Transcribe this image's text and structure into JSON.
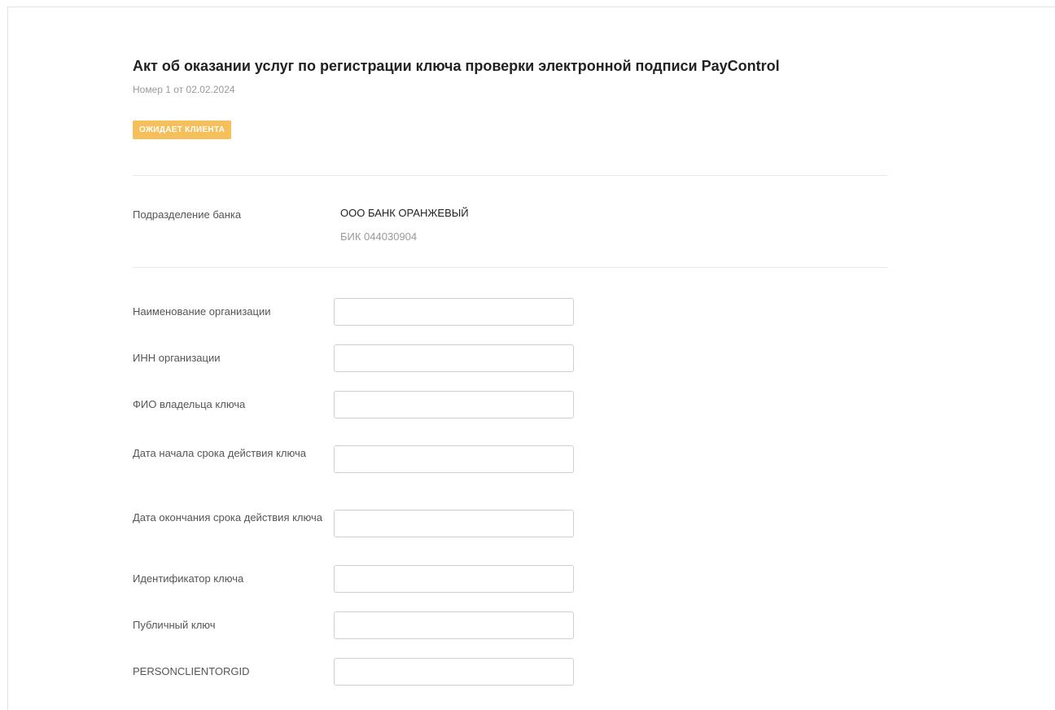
{
  "document": {
    "title": "Акт об оказании услуг по регистрации ключа проверки электронной подписи PayControl",
    "subtitle": "Номер 1 от 02.02.2024",
    "status_badge": "ОЖИДАЕТ КЛИЕНТА",
    "status_color": "#f5bf5b"
  },
  "bank": {
    "label": "Подразделение банка",
    "name": "ООО БАНК ОРАНЖЕВЫЙ",
    "bik": "БИК 044030904"
  },
  "form": {
    "fields": [
      {
        "label": "Наименование организации",
        "value": ""
      },
      {
        "label": "ИНН организации",
        "value": ""
      },
      {
        "label": "ФИО владельца ключа",
        "value": ""
      },
      {
        "label": "Дата начала срока действия ключа",
        "value": ""
      },
      {
        "label": "Дата окончания срока действия ключа",
        "value": ""
      },
      {
        "label": "Идентификатор ключа",
        "value": ""
      },
      {
        "label": "Публичный ключ",
        "value": ""
      },
      {
        "label": "PERSONCLIENTORGID",
        "value": ""
      }
    ]
  }
}
